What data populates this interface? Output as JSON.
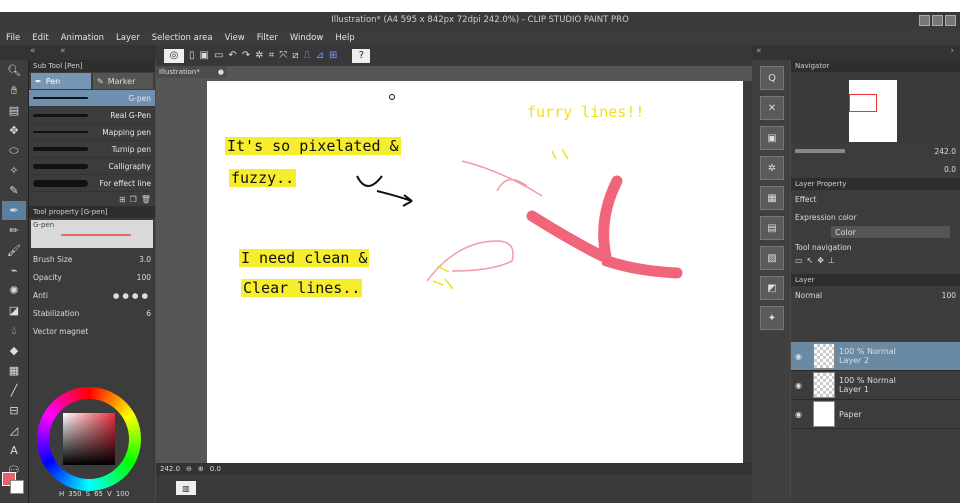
{
  "window": {
    "title": "Illustration* (A4 595 x 842px 72dpi 242.0%) - CLIP STUDIO PAINT PRO"
  },
  "menu": [
    "File",
    "Edit",
    "Animation",
    "Layer",
    "Selection area",
    "View",
    "Filter",
    "Window",
    "Help"
  ],
  "document_tab": "Illustration*",
  "subtool": {
    "header": "Sub Tool [Pen]",
    "tabs": [
      {
        "label": "Pen"
      },
      {
        "label": "Marker"
      }
    ],
    "brushes": [
      "G-pen",
      "Real G-Pen",
      "Mapping pen",
      "Turnip pen",
      "Calligraphy",
      "For effect line"
    ]
  },
  "toolprop": {
    "header": "Tool property [G-pen]",
    "preset": "G-pen",
    "brush_size_label": "Brush Size",
    "brush_size_value": "3.0",
    "opacity_label": "Opacity",
    "opacity_value": "100",
    "antialias_label": "Anti",
    "stabilization_label": "Stabilization",
    "stabilization_value": "6",
    "vector_magnet_label": "Vector magnet"
  },
  "color": {
    "h": "350",
    "s": "65",
    "v": "100",
    "main": "#e8606e"
  },
  "status": {
    "zoom": "242.0",
    "angle": "0.0"
  },
  "navigator": {
    "header": "Navigator",
    "zoom": "242.0",
    "angle": "0.0"
  },
  "layer_property": {
    "header": "Layer Property",
    "effect_label": "Effect",
    "expression_label": "Expression color",
    "expression_value": "Color",
    "tool_nav_label": "Tool navigation"
  },
  "layers": {
    "header": "Layer",
    "blend": "Normal",
    "opacity": "100",
    "items": [
      {
        "mode": "100 % Normal",
        "name": "Layer 2"
      },
      {
        "mode": "100 % Normal",
        "name": "Layer 1"
      },
      {
        "mode": "",
        "name": "Paper"
      }
    ]
  },
  "canvas_text": {
    "line1": "It's so pixelated &",
    "line2": "fuzzy..",
    "line3": "I need clean &",
    "line4": "Clear lines..",
    "line5": "furry lines!!"
  }
}
